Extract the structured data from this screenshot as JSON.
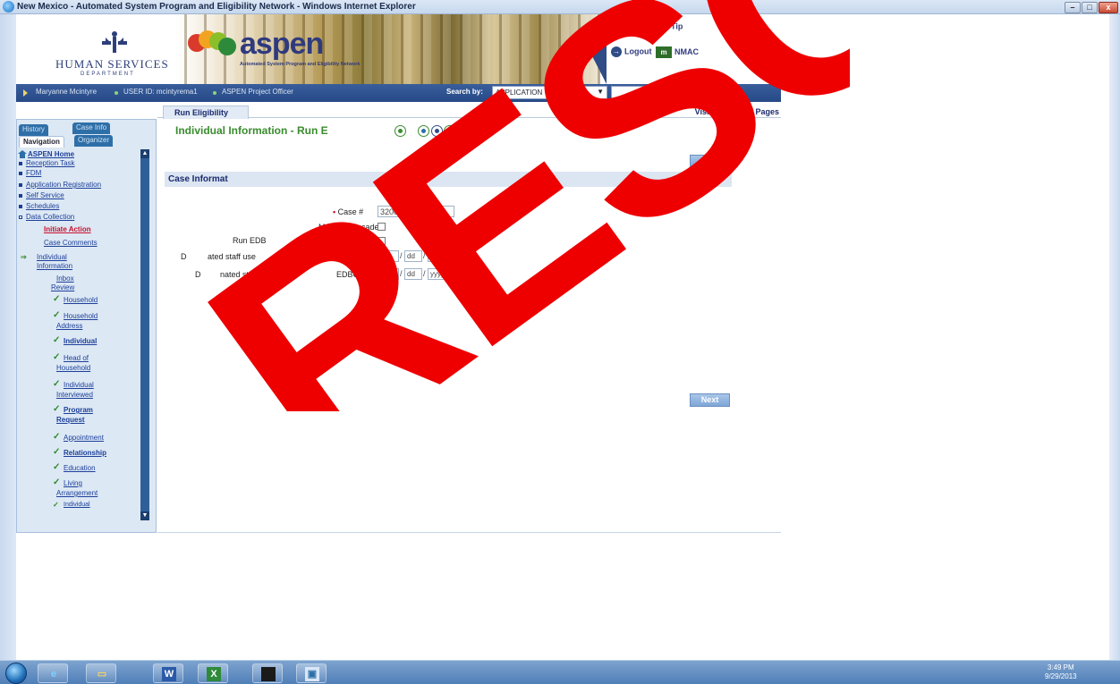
{
  "window": {
    "title": "New Mexico - Automated System Program and Eligibility Network - Windows Internet Explorer",
    "min_label": "–",
    "max_label": "□",
    "close_label": "x"
  },
  "header": {
    "hs_name": "HUMAN SERVICES",
    "hs_dept": "DEPARTMENT",
    "aspen_word": "aspen",
    "aspen_sub": "Automated System Program and Eligibility Network",
    "help_label": "Help",
    "tip_label": "Tip",
    "logout_label": "Logout",
    "nmac_label": "NMAC"
  },
  "statusbar": {
    "user_name": "Maryanne Mcintyre",
    "user_id": "USER ID: mcintyrema1",
    "role": "ASPEN Project Officer",
    "search_label": "Search by:",
    "search_option": "APPLICATION",
    "search_value": "",
    "go_label": "GO",
    "info_label": "i",
    "date": "29 August 2013"
  },
  "nav": {
    "tabs": {
      "history": "History",
      "case_info": "Case Info",
      "navigation": "Navigation",
      "organizer": "Organizer"
    },
    "items": {
      "aspen_home": "ASPEN Home",
      "reception_task": "Reception Task",
      "fdm": "FDM",
      "application_registration": "Application Registration",
      "self_service": "Self Service",
      "schedules": "Schedules",
      "data_collection": "Data Collection",
      "initiate_action": "Initiate Action",
      "case_comments": "Case Comments",
      "individual_information_1": "Individual",
      "individual_information_2": "Information",
      "inbox_review_1": "Inbox",
      "inbox_review_2": "Review",
      "household": "Household",
      "household_address_1": "Household",
      "household_address_2": "Address",
      "individual": "Individual",
      "head_of_household_1": "Head of",
      "head_of_household_2": "Household",
      "individual_interviewed_1": "Individual",
      "individual_interviewed_2": "Interviewed",
      "program_request_1": "Program",
      "program_request_2": "Request",
      "appointment": "Appointment",
      "relationship": "Relationship",
      "education": "Education",
      "living_arrangement_1": "Living",
      "living_arrangement_2": "Arrangement",
      "individual_partial": "Individual"
    }
  },
  "main": {
    "tab_label": "Run Eligibility",
    "visited": "Visited 33 of 45 Pages",
    "heading": "Individual Information - Run E",
    "next_label": "Next",
    "section_title": "Case Informat",
    "form": {
      "case_label": "Case #",
      "case_value": "320018486",
      "manual_cascade_label": "Manual Cascade",
      "run_edbc_label_a": "Run EDB",
      "run_edbc_label_b": "Conversion Mo",
      "designated_from_a": "D",
      "designated_from_b": "ated staff use",
      "designated_from_c": "Run ED",
      "designated_from_d": "om",
      "designated_thru_a": "D",
      "designated_thru_b": "nated staff use",
      "designated_thru_c": "EDBC M",
      "mm": "mm",
      "dd": "dd",
      "yyyy": "yyyy"
    }
  },
  "stamp": {
    "text": "RESC",
    "color": "#ee0000"
  },
  "taskbar": {
    "clock_time": "3:49 PM",
    "clock_date": "9/29/2013",
    "apps": [
      "internet-explorer",
      "windows-explorer",
      "word",
      "excel",
      "command-window",
      "remote-desktop"
    ]
  },
  "colors": {
    "statusbar": "#264a86",
    "heading_green": "#3a8c2e",
    "nav_panel": "#dce8f4",
    "link_blue": "#1d3f9a",
    "alert_red": "#c8102e"
  }
}
